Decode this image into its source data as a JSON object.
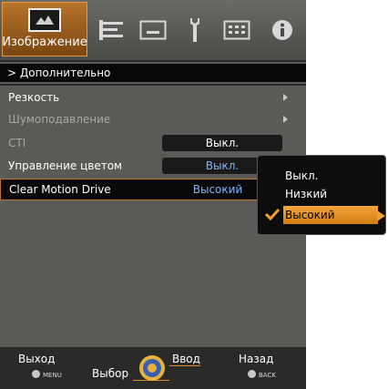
{
  "tabs": {
    "active_label": "Изображение",
    "icons": [
      "picture-icon",
      "setup-icon",
      "screen-icon",
      "wrench-icon",
      "keyboard-icon",
      "info-icon"
    ]
  },
  "header": {
    "title": "> Дополнительно"
  },
  "menu": {
    "items": [
      {
        "label": "Резкость",
        "type": "submenu",
        "enabled": true
      },
      {
        "label": "Шумоподавление",
        "type": "submenu",
        "enabled": false
      },
      {
        "label": "CTI",
        "value": "Выкл.",
        "enabled": false
      },
      {
        "label": "Управление цветом",
        "value": "Выкл.",
        "enabled": true
      },
      {
        "label": "Clear Motion Drive",
        "value": "Высокий",
        "enabled": true,
        "selected": true
      }
    ]
  },
  "popup": {
    "options": [
      "Выкл.",
      "Низкий",
      "Высокий"
    ],
    "selected": "Высокий"
  },
  "footer": {
    "exit": "Выход",
    "menu_key": "MENU",
    "select": "Выбор",
    "enter": "Ввод",
    "back": "Назад",
    "back_key": "BACK"
  },
  "colors": {
    "accent": "#e39a43",
    "background": "#5a5a56",
    "highlight_value": "#7ab6ff"
  }
}
